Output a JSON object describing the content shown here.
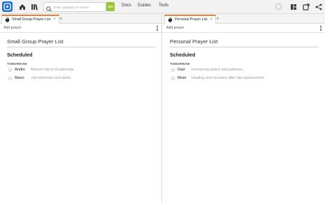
{
  "topbar": {
    "search_placeholder": "Enter passage or search",
    "go_label": "GO",
    "nav": [
      "Docs",
      "Guides",
      "Tools"
    ]
  },
  "panes": [
    {
      "tab_title": "Small Group Prayer List",
      "add_prayer": "Add prayer",
      "list_title": "Small Group Prayer List",
      "section": "Scheduled",
      "group_label": "TOMORROW",
      "items": [
        {
          "name": "Andre",
          "desc": "Mission trip to Guatemala"
        },
        {
          "name": "Marci",
          "desc": "Job interview next week."
        }
      ]
    },
    {
      "tab_title": "Personal Prayer List",
      "add_prayer": "Add prayer",
      "list_title": "Personal Prayer List",
      "section": "Scheduled",
      "group_label": "TOMORROW",
      "items": [
        {
          "name": "Dad",
          "desc": "Increasing peace and patience."
        },
        {
          "name": "Mom",
          "desc": "Healing and recovery after hip replacement."
        }
      ]
    }
  ],
  "colors": {
    "logo": "#1f6fd1",
    "go_button": "#9cc437",
    "tab_accent": "#e8813a"
  },
  "icons": [
    "logo-icon",
    "home-icon",
    "library-icon",
    "search-icon",
    "status-circle-icon",
    "layout-icon",
    "sync-icon",
    "share-icon",
    "flame-icon",
    "close-icon",
    "plus-icon",
    "kebab-icon"
  ]
}
